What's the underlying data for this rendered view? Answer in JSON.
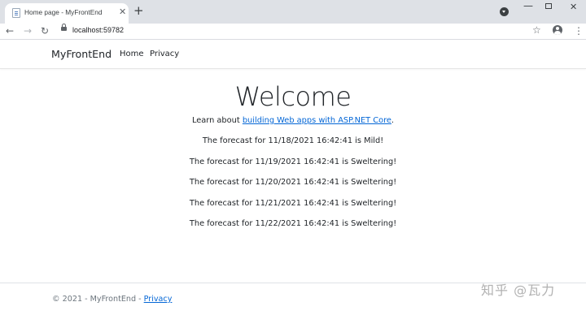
{
  "browser": {
    "tab_title": "Home page - MyFrontEnd",
    "tab_close": "✕",
    "new_tab": "+",
    "url": "localhost:59782",
    "icons": [
      "back-arrow-icon",
      "forward-arrow-icon",
      "reload-icon",
      "lock-icon",
      "star-icon",
      "account-icon",
      "menu-icon"
    ]
  },
  "navbar": {
    "brand": "MyFrontEnd",
    "links": [
      "Home",
      "Privacy"
    ]
  },
  "main": {
    "title": "Welcome",
    "learn_prefix": "Learn about ",
    "learn_link": "building Web apps with ASP.NET Core",
    "learn_suffix": ".",
    "forecasts": [
      "The forecast for 11/18/2021 16:42:41 is Mild!",
      "The forecast for 11/19/2021 16:42:41 is Sweltering!",
      "The forecast for 11/20/2021 16:42:41 is Sweltering!",
      "The forecast for 11/21/2021 16:42:41 is Sweltering!",
      "The forecast for 11/22/2021 16:42:41 is Sweltering!"
    ]
  },
  "footer": {
    "text": "© 2021 - MyFrontEnd - ",
    "privacy_link": "Privacy"
  },
  "watermark": "知乎 @瓦力",
  "colors": {
    "link": "#0366d6",
    "tabstrip": "#dee1e6",
    "footer_text": "#6c757d"
  }
}
